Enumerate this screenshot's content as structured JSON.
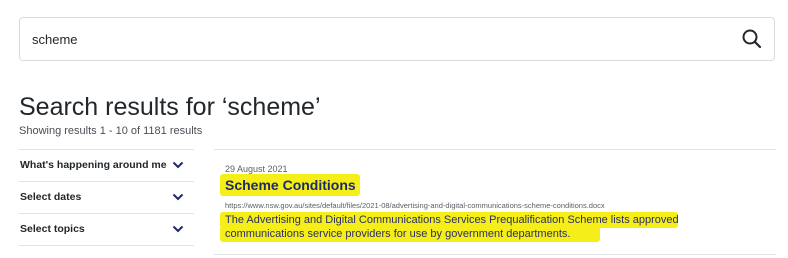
{
  "search": {
    "value": "scheme",
    "button_icon": "search-icon"
  },
  "heading": {
    "title": "Search results for ‘scheme’",
    "count": "Showing results 1 - 10 of 1181 results"
  },
  "filters": [
    {
      "label": "What's happening around me",
      "icon": "chevron-down-icon"
    },
    {
      "label": "Select dates",
      "icon": "chevron-down-icon"
    },
    {
      "label": "Select topics",
      "icon": "chevron-down-icon"
    }
  ],
  "results": [
    {
      "date": "29 August 2021",
      "title": "Scheme Conditions",
      "url": "https://www.nsw.gov.au/sites/default/files/2021-08/advertising-and-digital-communications-scheme-conditions.docx",
      "description": "The Advertising and Digital Communications Services Prequalification Scheme lists approved communications service providers for use by government departments."
    }
  ],
  "colors": {
    "highlight": "#f6ee19",
    "title_link": "#1b2a6b",
    "divider": "#e1e3e6"
  }
}
